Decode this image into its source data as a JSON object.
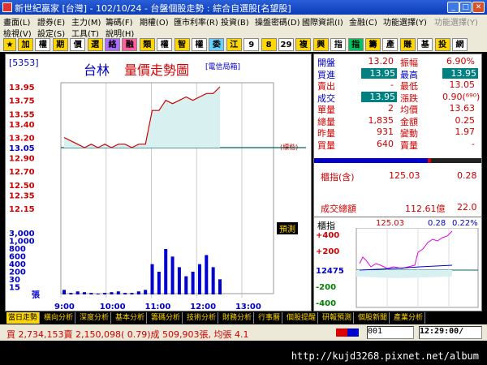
{
  "window": {
    "title": "新世紀贏家 [台灣] - 102/10/24 - 台盤個股走勢 : 綜合自選股[名望股]"
  },
  "menu1": [
    "畫面(L)",
    "證券(E)",
    "主力(M)",
    "籌碼(F)",
    "期權(O)",
    "匯市利率(R)",
    "投資(B)",
    "操盤密碼(D)",
    "國際資訊(I)",
    "金融(C)",
    "功能選擇(Y)",
    "功能選擇(Y)"
  ],
  "menu2": [
    "檢視(V)",
    "設定(S)",
    "工具(T)",
    "說明(H)"
  ],
  "toolbar": [
    "加",
    "權",
    "期",
    "價",
    "選",
    "絡",
    "融",
    "類",
    "權",
    "智",
    "權",
    "委",
    "江",
    "9",
    "8",
    "29",
    "複",
    "興",
    "指",
    "指",
    "籌",
    "產",
    "賺",
    "基",
    "投",
    "網"
  ],
  "chart_header": {
    "code": "[5353]",
    "name": "台林",
    "title": "量價走勢圖",
    "source": "[電信局箱]"
  },
  "price_axis": [
    "13.95",
    "13.75",
    "13.55",
    "13.40",
    "13.20",
    "13.05",
    "12.90",
    "12.70",
    "12.50",
    "12.35",
    "12.15"
  ],
  "ref_note": "(標楷)",
  "vol_axis": [
    "3,000",
    "1,000",
    "800",
    "600",
    "400",
    "200",
    "30",
    "15",
    "張"
  ],
  "time_axis": [
    "9:00",
    "10:00",
    "11:00",
    "12:00",
    "13:00"
  ],
  "forecast_label": "預測",
  "quote": [
    {
      "l": "開盤",
      "v": "13.20",
      "l2": "振幅",
      "v2": "6.90%"
    },
    {
      "l": "買進",
      "v": "13.95",
      "l2": "最高",
      "v2": "13.95"
    },
    {
      "l": "賣出",
      "v": "-",
      "l2": "最低",
      "v2": "13.05"
    },
    {
      "l": "成交",
      "v": "13.95",
      "l2": "漲跌",
      "v2": "0.90(⁶⁹⁰)"
    },
    {
      "l": "單量",
      "v": "2",
      "l2": "均價",
      "v2": "13.63"
    },
    {
      "l": "總量",
      "v": "1,835",
      "l2": "金額",
      "v2": "0.25"
    },
    {
      "l": "昨量",
      "v": "931",
      "l2": "變動",
      "v2": "1.97"
    },
    {
      "l": "買量",
      "v": "640",
      "l2": "賣量",
      "v2": "-"
    }
  ],
  "index_info": {
    "label": "櫃指(含)",
    "value": "125.03",
    "change": "0.28",
    "total_label": "成交總額",
    "total_value": "112.61億",
    "total_change": "22.0"
  },
  "mini_chart": {
    "label": "櫃指",
    "value": "125.03",
    "change": "0.28",
    "pct": "0.22%",
    "axis": [
      "+400",
      "+200",
      "12475",
      "-200",
      "-400"
    ]
  },
  "tabs": [
    "當日走勢",
    "橫向分析",
    "深度分析",
    "基本分析",
    "籌碼分析",
    "技術分析",
    "財務分析",
    "行事曆",
    "個股提醒",
    "研報預測",
    "個股新聞",
    "產業分析"
  ],
  "status": {
    "text": "買 2,734,153賣 2,150,098( 0.79)成 509,903張, 均張 4.1",
    "page": "001",
    "time": "12:29:00/"
  },
  "watermark": "http://kujd3268.pixnet.net/album",
  "chart_data": {
    "type": "line",
    "title": "量價走勢圖",
    "x": [
      "9:00",
      "9:10",
      "9:20",
      "9:30",
      "9:40",
      "9:50",
      "10:00",
      "10:10",
      "10:20",
      "10:30",
      "10:40",
      "10:50",
      "11:00",
      "11:05",
      "11:10",
      "11:15",
      "11:20",
      "11:30",
      "11:40",
      "11:50",
      "12:00",
      "12:10",
      "12:20",
      "12:29"
    ],
    "series": [
      {
        "values": [
          13.2,
          13.15,
          13.1,
          13.05,
          13.1,
          13.05,
          13.1,
          13.05,
          13.1,
          13.1,
          13.05,
          13.1,
          13.1,
          13.6,
          13.6,
          13.75,
          13.7,
          13.75,
          13.8,
          13.75,
          13.8,
          13.85,
          13.85,
          13.95
        ]
      }
    ],
    "ylim": [
      12.15,
      13.95
    ],
    "volume": [
      30,
      10,
      20,
      15,
      10,
      5,
      10,
      15,
      20,
      10,
      10,
      20,
      30,
      200,
      150,
      300,
      250,
      180,
      120,
      150,
      200,
      260,
      180,
      100
    ]
  }
}
